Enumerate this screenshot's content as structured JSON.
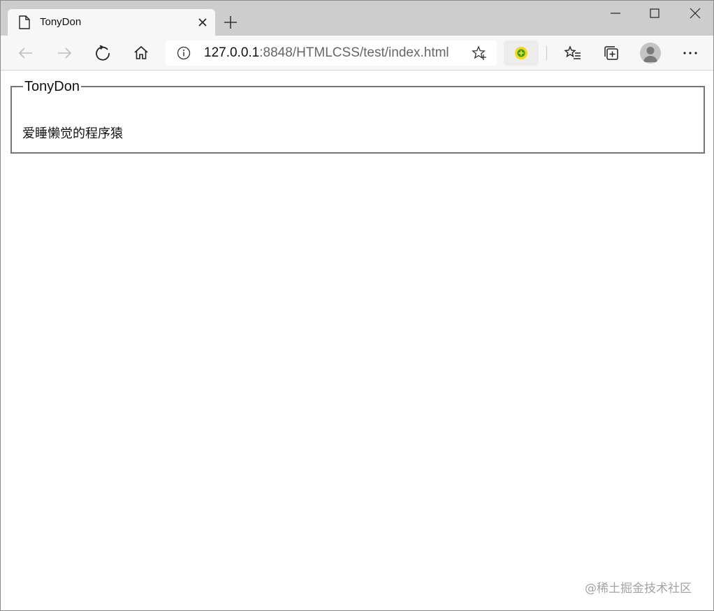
{
  "browser": {
    "tab": {
      "title": "TonyDon",
      "icon": "page-icon"
    },
    "toolbar": {
      "back": "back-arrow-icon",
      "forward": "forward-arrow-icon",
      "refresh": "refresh-icon",
      "home": "home-icon",
      "address": {
        "host": "127.0.0.1",
        "rest": ":8848/HTMLCSS/test/index.html"
      },
      "extension_color": "#f5d90a",
      "favorites": "favorites-list-icon",
      "collections": "collections-icon",
      "more": "more-icon"
    }
  },
  "page": {
    "fieldset": {
      "legend": "TonyDon",
      "text": "爱睡懒觉的程序猿"
    },
    "watermark": "@稀土掘金技术社区"
  }
}
